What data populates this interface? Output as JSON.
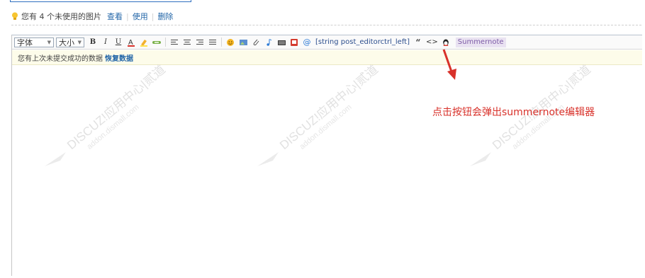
{
  "notice": {
    "text": "您有 4 个未使用的图片",
    "links": [
      "查看",
      "使用",
      "删除"
    ]
  },
  "toolbar": {
    "font_select": "字体",
    "size_select": "大小",
    "bold": "B",
    "italic": "I",
    "underline": "U",
    "string_tag": "[string post_editorctrl_left]",
    "quote": "“",
    "code": "<>",
    "summernote": "Summernote"
  },
  "restore": {
    "text": "您有上次未提交成功的数据",
    "link": "恢复数据"
  },
  "callout": "点击按钮会弹出summernote编辑器",
  "watermark": {
    "main": "DISCUZ!应用中心|贰道",
    "sub": "addon.dismall.com"
  },
  "colors": {
    "accent": "#2366a8",
    "callout": "#d8312a",
    "summernote_bg": "#e9e2f1"
  }
}
